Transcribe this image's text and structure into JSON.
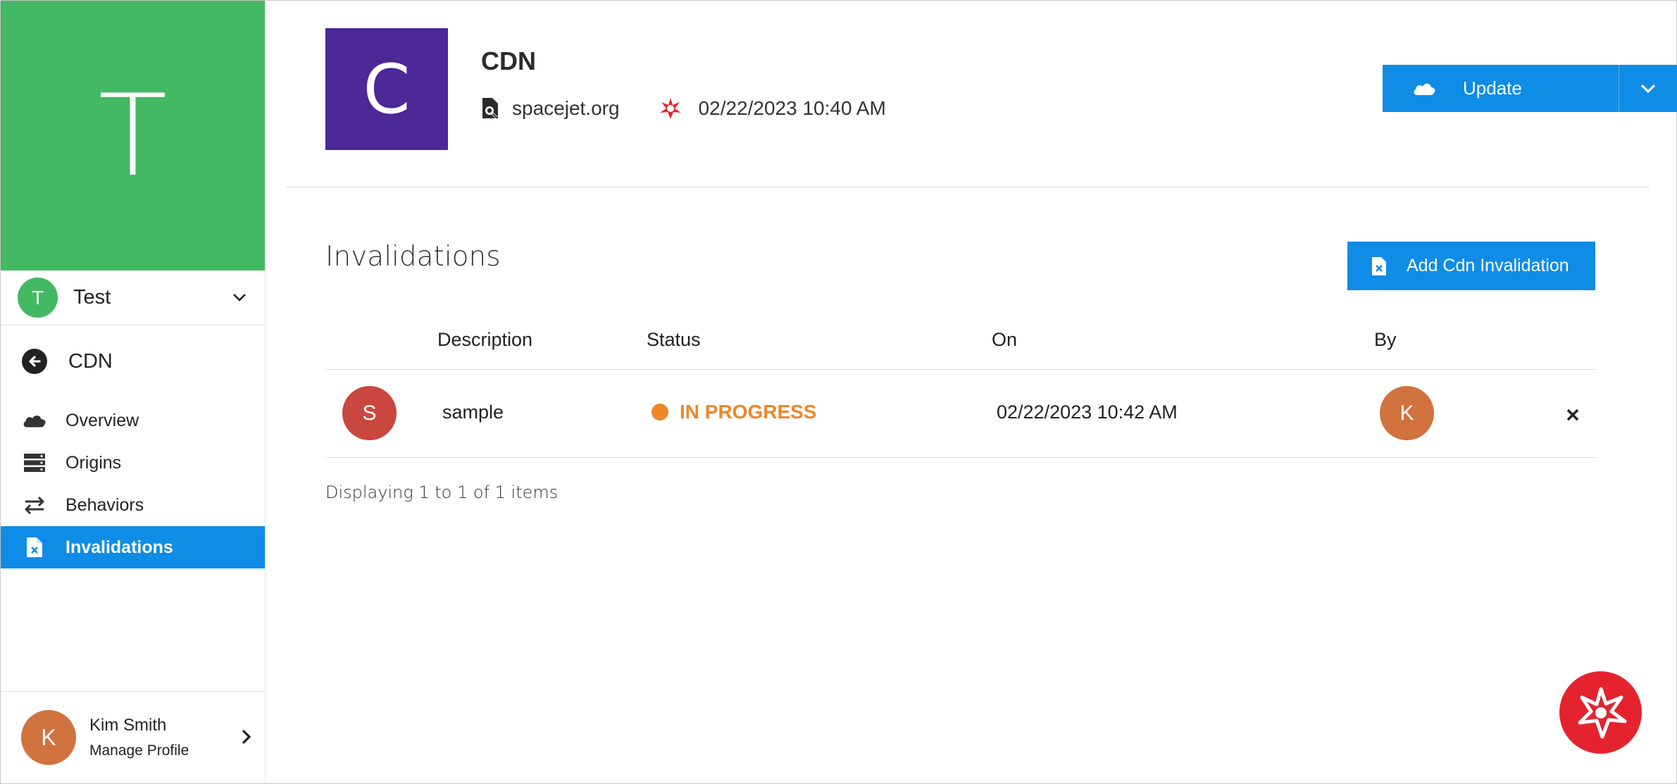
{
  "workspace": {
    "banner_letter": "T",
    "avatar_letter": "T",
    "name": "Test"
  },
  "sidebar": {
    "back_label": "CDN",
    "items": [
      {
        "label": "Overview",
        "icon": "cloud-icon"
      },
      {
        "label": "Origins",
        "icon": "server-icon"
      },
      {
        "label": "Behaviors",
        "icon": "arrows-exchange-icon"
      },
      {
        "label": "Invalidations",
        "icon": "file-x-icon",
        "active": true
      }
    ]
  },
  "profile": {
    "avatar_letter": "K",
    "name": "Kim Smith",
    "subtitle": "Manage Profile"
  },
  "header": {
    "logo_letter": "C",
    "title": "CDN",
    "domain": "spacejet.org",
    "timestamp": "02/22/2023 10:40 AM",
    "update_label": "Update"
  },
  "invalidations": {
    "title": "Invalidations",
    "add_label": "Add Cdn Invalidation",
    "columns": [
      "Description",
      "Status",
      "On",
      "By"
    ],
    "rows": [
      {
        "avatar_letter": "S",
        "description": "sample",
        "status": "IN PROGRESS",
        "on": "02/22/2023 10:42 AM",
        "by_letter": "K"
      }
    ],
    "pager": "Displaying 1 to 1 of 1 items"
  },
  "colors": {
    "workspace_green": "#43b963",
    "app_purple": "#4b2896",
    "primary_blue": "#0f8ce6",
    "status_orange": "#f0862a",
    "fab_red": "#e5232e"
  }
}
